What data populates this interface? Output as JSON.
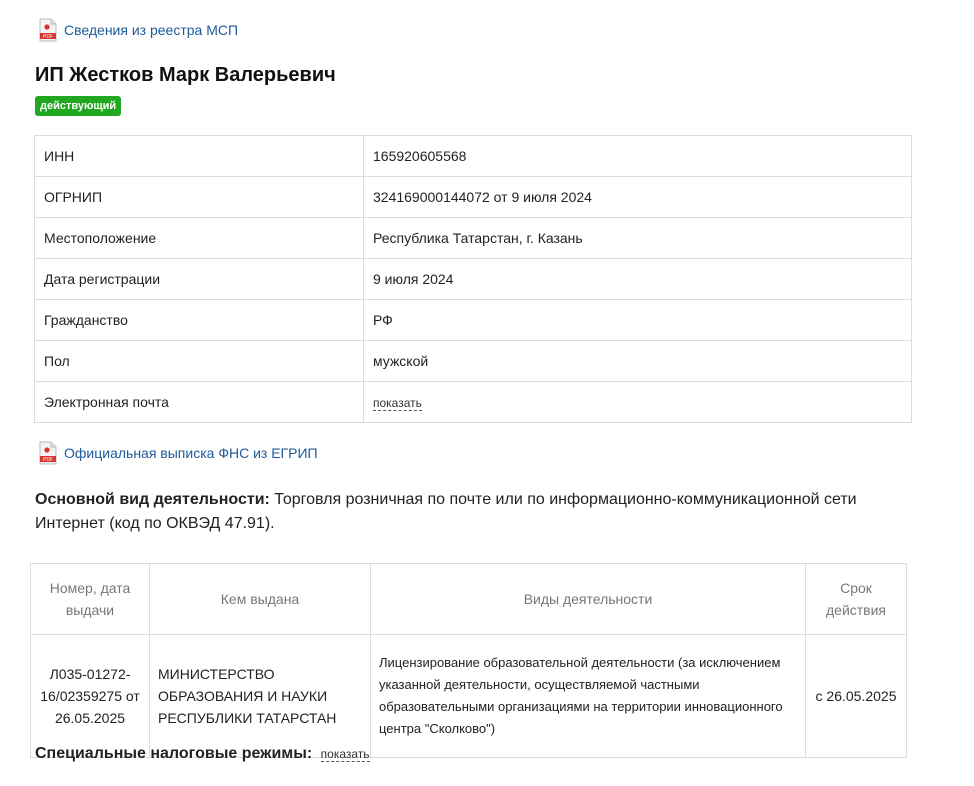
{
  "links": {
    "msp": "Сведения из реестра МСП",
    "egrip": "Официальная выписка ФНС из ЕГРИП",
    "pdf_icon_label": "PDF"
  },
  "entity": {
    "name": "ИП Жестков Марк Валерьевич",
    "status": "действующий"
  },
  "info_rows": [
    {
      "label": "ИНН",
      "value": "165920605568"
    },
    {
      "label": "ОГРНИП",
      "value": "324169000144072 от 9 июля 2024"
    },
    {
      "label": "Местоположение",
      "value": "Республика Татарстан, г. Казань"
    },
    {
      "label": "Дата регистрации",
      "value": "9 июля 2024"
    },
    {
      "label": "Гражданство",
      "value": "РФ"
    },
    {
      "label": "Пол",
      "value": "мужской"
    },
    {
      "label": "Электронная почта",
      "value": "показать"
    }
  ],
  "activity": {
    "label": "Основной вид деятельности:",
    "text": " Торговля розничная по почте или по информационно-коммуникационной сети Интернет (код по ОКВЭД 47.91)."
  },
  "license_table": {
    "headers": [
      "Номер, дата выдачи",
      "Кем выдана",
      "Виды деятельности",
      "Срок действия"
    ],
    "row": {
      "number": "Л035-01272-16/02359275 от 26.05.2025",
      "issuer": "МИНИСТЕРСТВО ОБРАЗОВАНИЯ И НАУКИ РЕСПУБЛИКИ ТАТАРСТАН",
      "activity": "Лицензирование образовательной деятельности (за исключением указанной деятельности, осуществляемой частными образовательными организациями на территории инновационного центра \"Сколково\")",
      "validity": "с 26.05.2025"
    }
  },
  "tax": {
    "label": "Специальные налоговые режимы:",
    "show": "показать"
  },
  "colors": {
    "link": "#1d5b9a",
    "badge": "#21a821",
    "pdf_red": "#d9342b"
  }
}
